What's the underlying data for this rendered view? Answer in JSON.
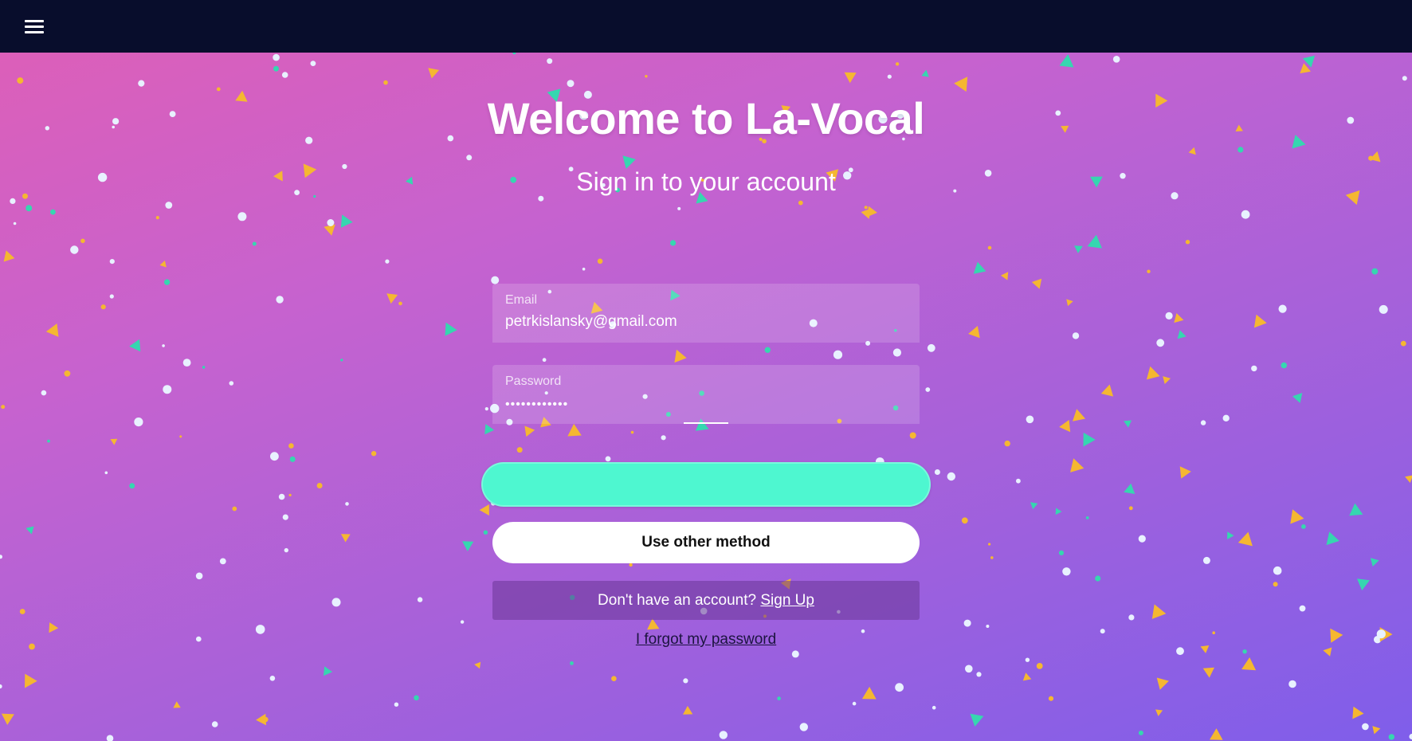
{
  "topbar": {
    "menu_icon": "hamburger-menu-icon",
    "background_color": "#080d2c"
  },
  "hero": {
    "title": "Welcome to La-Vocal",
    "subtitle": "Sign in to your account",
    "gradient_colors": [
      "#dc5fb9",
      "#c662cf",
      "#a661da",
      "#7f5eea"
    ]
  },
  "form": {
    "email": {
      "label": "Email",
      "value": "petrkislansky@gmail.com"
    },
    "password": {
      "label": "Password",
      "value": "••••••••••••"
    },
    "signin_button": {
      "state": "loading",
      "color": "#4ef7d0"
    },
    "other_method_label": "Use other method",
    "signup_prompt": "Don't have an account?",
    "signup_link": "Sign Up",
    "forgot_password_link": "I forgot my password"
  },
  "confetti_colors": [
    "#e8f1ff",
    "#f5b731",
    "#36d6b0"
  ]
}
